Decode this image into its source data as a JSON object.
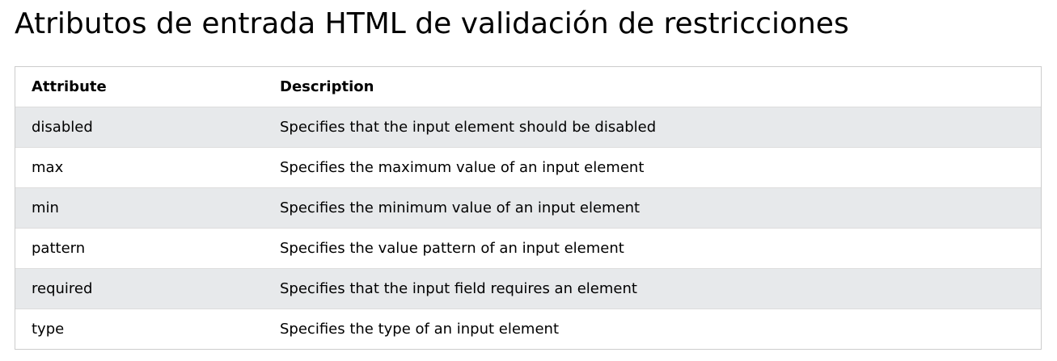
{
  "page": {
    "title": "Atributos de entrada HTML de validación de restricciones"
  },
  "table": {
    "headers": {
      "attribute": "Attribute",
      "description": "Description"
    },
    "rows": [
      {
        "attribute": "disabled",
        "description": "Specifies that the input element should be disabled"
      },
      {
        "attribute": "max",
        "description": "Specifies the maximum value of an input element"
      },
      {
        "attribute": "min",
        "description": "Specifies the minimum value of an input element"
      },
      {
        "attribute": "pattern",
        "description": "Specifies the value pattern of an input element"
      },
      {
        "attribute": "required",
        "description": "Specifies that the input field requires an element"
      },
      {
        "attribute": "type",
        "description": "Specifies the type of an input element"
      }
    ]
  },
  "colors": {
    "stripe": "#e7e9eb",
    "border": "#cccccc",
    "text": "#000000"
  }
}
